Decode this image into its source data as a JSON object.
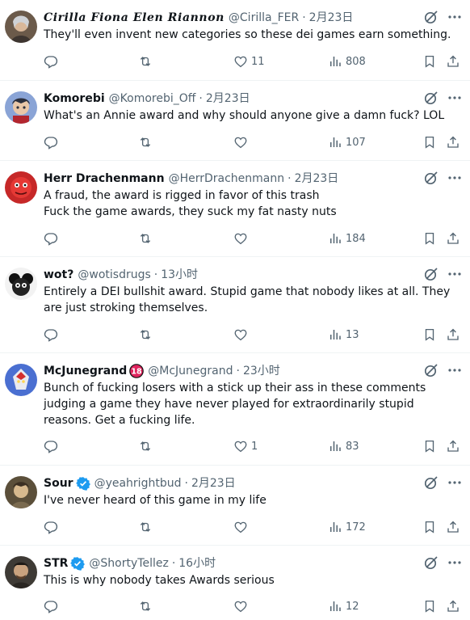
{
  "tweets": [
    {
      "display_name": "Cirilla Fiona Elen Riannon",
      "handle": "@Cirilla_FER",
      "time": "2月23日",
      "lines": [
        "They'll even invent new categories so these dei games earn something."
      ],
      "replies": "",
      "retweets": "",
      "likes": "11",
      "views": "808",
      "badge": "",
      "avatar_icon": "avatar-portrait-woman"
    },
    {
      "display_name": "Komorebi",
      "handle": "@Komorebi_Off",
      "time": "2月23日",
      "lines": [
        "What's an Annie award and why should anyone give a damn fuck? LOL"
      ],
      "replies": "",
      "retweets": "",
      "likes": "",
      "views": "107",
      "badge": "",
      "avatar_icon": "avatar-anime-character"
    },
    {
      "display_name": "Herr Drachenmann",
      "handle": "@HerrDrachenmann",
      "time": "2月23日",
      "lines": [
        "A fraud, the award is rigged in favor of this trash",
        "Fuck the game awards, they suck my fat nasty nuts"
      ],
      "replies": "",
      "retweets": "",
      "likes": "",
      "views": "184",
      "badge": "",
      "avatar_icon": "avatar-red-dragon"
    },
    {
      "display_name": "wot?",
      "handle": "@wotisdrugs",
      "time": "13小时",
      "lines": [
        "Entirely a DEI bullshit award. Stupid game that nobody likes at all. They are just stroking themselves."
      ],
      "replies": "",
      "retweets": "",
      "likes": "",
      "views": "13",
      "badge": "",
      "avatar_icon": "avatar-cartoon-bw"
    },
    {
      "display_name": "McJunegrand",
      "handle": "@McJunegrand",
      "time": "23小时",
      "lines": [
        "Bunch of fucking losers with a stick up their ass in these comments judging a game they have never played for extraordinarily stupid reasons. Get a fucking life."
      ],
      "replies": "",
      "retweets": "",
      "likes": "1",
      "views": "83",
      "badge": "18",
      "avatar_icon": "avatar-robot-mecha"
    },
    {
      "display_name": "Sour",
      "handle": "@yeahrightbud",
      "time": "2月23日",
      "lines": [
        "I've never heard of this game in my life"
      ],
      "replies": "",
      "retweets": "",
      "likes": "",
      "views": "172",
      "badge": "verified",
      "avatar_icon": "avatar-character-portrait"
    },
    {
      "display_name": "STR",
      "handle": "@ShortyTellez",
      "time": "16小时",
      "lines": [
        "This is why nobody takes Awards serious"
      ],
      "replies": "",
      "retweets": "",
      "likes": "",
      "views": "12",
      "badge": "verified",
      "avatar_icon": "avatar-man-portrait"
    }
  ],
  "icons": {
    "grok": "grok-icon",
    "more": "more-icon",
    "reply": "reply-icon",
    "retweet": "retweet-icon",
    "like": "like-icon",
    "views": "views-icon",
    "bookmark": "bookmark-icon",
    "share": "share-icon"
  },
  "colors": {
    "text": "#0f1419",
    "secondary": "#536471",
    "verified": "#1d9bf0",
    "badge_18": "#e0245e",
    "divider": "#eff3f4"
  }
}
